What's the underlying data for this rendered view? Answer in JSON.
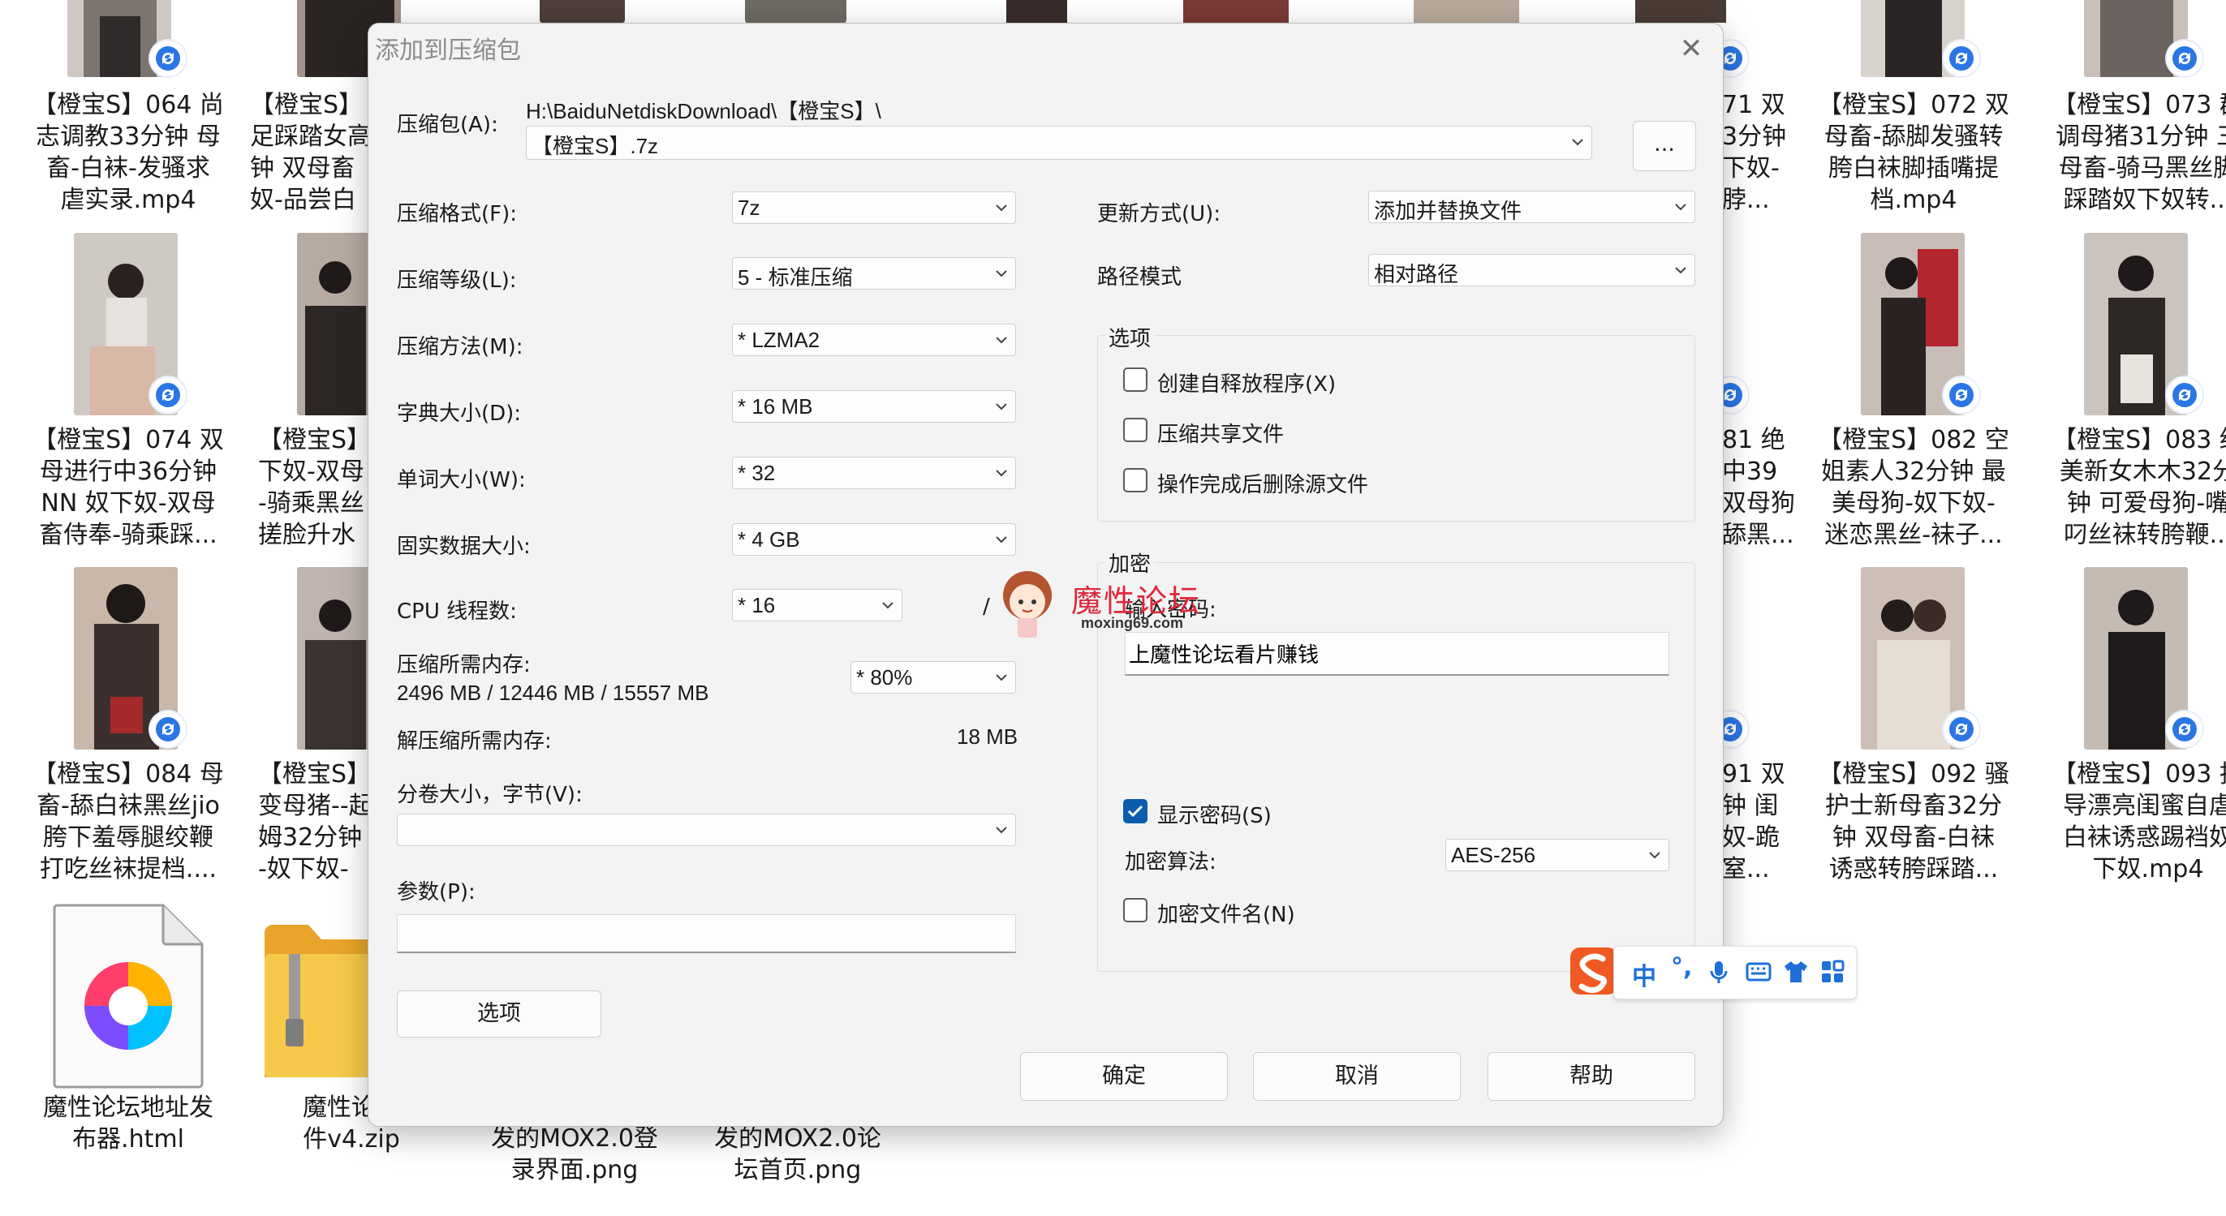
{
  "files": {
    "row1": [
      {
        "label": "【橙宝S】064 尚\n志调教33分钟 母\n畜-白袜-发骚求\n虐实录.mp4"
      },
      {
        "label": "【橙宝S】\n足踩踏女高\n钟 双母畜\n奴-品尝白"
      },
      {
        "label": "71 双\n3分钟\n下奴-\n脖..."
      },
      {
        "label": "【橙宝S】072 双\n母畜-舔脚发骚转\n胯白袜脚插嘴提\n档.mp4"
      },
      {
        "label": "【橙宝S】073 群\n调母猪31分钟 三\n母畜-骑马黑丝脚\n踩踏奴下奴转..."
      }
    ],
    "row2": [
      {
        "label": "【橙宝S】074 双\n母进行中36分钟\nNN 奴下奴-双母\n畜侍奉-骑乘踩..."
      },
      {
        "label": "【橙宝S】\n下奴-双母\n-骑乘黑丝\n搓脸升水"
      },
      {
        "label": "81 绝\n中39\n双母狗\n舔黑..."
      },
      {
        "label": "【橙宝S】082 空\n姐素人32分钟 最\n美母狗-奴下奴-\n迷恋黑丝-袜子..."
      },
      {
        "label": "【橙宝S】083 绝\n美新女木木32分\n钟 可爱母狗-嘴\n叼丝袜转胯鞭..."
      }
    ],
    "row3": [
      {
        "label": "【橙宝S】084 母\n畜-舔白袜黑丝jio\n胯下羞辱腿绞鞭\n打吃丝袜提档...."
      },
      {
        "label": "【橙宝S】\n变母猪--起\n姆32分钟\n-奴下奴-"
      },
      {
        "label": "91 双\n钟 闺\n奴-跪\n窒..."
      },
      {
        "label": "【橙宝S】092 骚\n护士新母畜32分\n钟 双母畜-白袜\n诱惑转胯踩踏..."
      },
      {
        "label": "【橙宝S】093 指\n导漂亮闺蜜自虐\n白袜诱惑踢裆奴\n下奴.mp4"
      }
    ],
    "row4": [
      {
        "label": "魔性论坛地址发\n布器.html"
      },
      {
        "label": "魔性论坛\n件v4.zip"
      },
      {
        "label": "发的MOX2.0登\n录界面.png"
      },
      {
        "label": "发的MOX2.0论\n坛首页.png"
      }
    ]
  },
  "dialog": {
    "title": "添加到压缩包",
    "archive_label": "压缩包(A):",
    "archive_path": "H:\\BaiduNetdiskDownload\\【橙宝S】\\",
    "archive_name": "【橙宝S】.7z",
    "browse_label": "...",
    "format_label": "压缩格式(F):",
    "format_value": "7z",
    "level_label": "压缩等级(L):",
    "level_value": "5 - 标准压缩",
    "method_label": "压缩方法(M):",
    "method_value": "*  LZMA2",
    "dict_label": "字典大小(D):",
    "dict_value": "*  16 MB",
    "word_label": "单词大小(W):",
    "word_value": "*  32",
    "solid_label": "固实数据大小:",
    "solid_value": "*  4 GB",
    "cpu_label": "CPU 线程数:",
    "cpu_value": "*  16",
    "cpu_slash": "/",
    "mem_label": "压缩所需内存:",
    "mem_value": "2496 MB / 12446 MB / 15557 MB",
    "mem_percent": "* 80%",
    "decomp_label": "解压缩所需内存:",
    "decomp_value": "18 MB",
    "split_label": "分卷大小，字节(V):",
    "split_value": "",
    "params_label": "参数(P):",
    "params_value": "",
    "options_button": "选项",
    "update_label": "更新方式(U):",
    "update_value": "添加并替换文件",
    "pathmode_label": "路径模式",
    "pathmode_value": "相对路径",
    "options_group": "选项",
    "opt_sfx": "创建自释放程序(X)",
    "opt_shared": "压缩共享文件",
    "opt_delete": "操作完成后删除源文件",
    "encrypt_group": "加密",
    "password_label": "输入密码:",
    "password_value": "上魔性论坛看片赚钱",
    "show_password": "显示密码(S)",
    "enc_method_label": "加密算法:",
    "enc_method_value": "AES-256",
    "encrypt_names": "加密文件名(N)",
    "ok_button": "确定",
    "cancel_button": "取消",
    "help_button": "帮助"
  },
  "watermark": {
    "title": "魔性论坛",
    "url": "moxing69.com"
  },
  "ime": {
    "mode": "中",
    "punct": "°,"
  },
  "colors": {
    "accent": "#0b5cad",
    "watermark_red": "#e0273a",
    "ime_orange": "#f05a22",
    "ime_blue": "#1e6fd9"
  }
}
